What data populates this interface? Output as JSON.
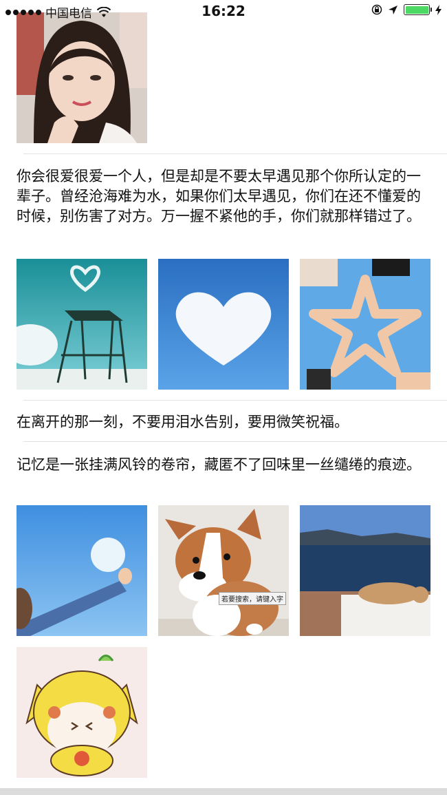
{
  "status_bar": {
    "carrier": "中国电信",
    "time": "16:22",
    "battery_level": 1.0,
    "battery_color": "#4cd964"
  },
  "posts": [
    {
      "text": "",
      "images": [
        "portrait-woman"
      ]
    },
    {
      "text": "你会很爱很爱一个人，但是却是不要太早遇见那个你所认定的一辈子。曾经沧海难为水，如果你们太早遇见，你们在还不懂爱的时候，别伤害了对方。万一握不紧他的手，你们就那样错过了。",
      "images": [
        "heart-cloud-tower",
        "heart-cloud-sky",
        "hands-star"
      ]
    },
    {
      "text": "在离开的那一刻，不要用泪水告别，要用微笑祝福。",
      "images": []
    },
    {
      "text": "记忆是一张挂满风铃的卷帘，藏匿不了回味里一丝缱绻的痕迹。",
      "images": [
        "balloon-hand",
        "corgi-puppy",
        "corgi-lake",
        "pikachu-cartoon"
      ]
    }
  ],
  "puppy_overlay_text": "若要搜索，请键入字"
}
